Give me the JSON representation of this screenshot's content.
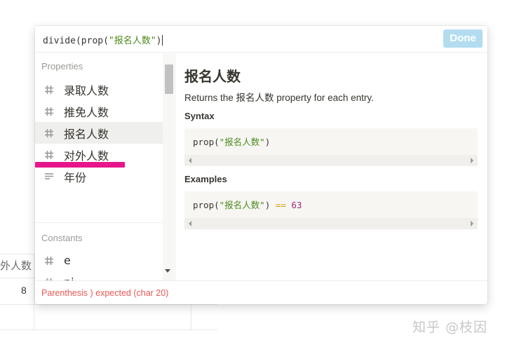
{
  "formula": {
    "prefix": "divide(prop(",
    "string": "\"报名人数\"",
    "suffix": ")"
  },
  "done_label": "Done",
  "properties_title": "Properties",
  "properties": [
    {
      "label": "录取人数",
      "icon": "number-hash-icon"
    },
    {
      "label": "推免人数",
      "icon": "number-hash-icon"
    },
    {
      "label": "报名人数",
      "icon": "number-hash-icon",
      "selected": true
    },
    {
      "label": "对外人数",
      "icon": "number-hash-icon"
    },
    {
      "label": "年份",
      "icon": "text-lines-icon"
    }
  ],
  "constants_title": "Constants",
  "constants": [
    {
      "label": "e",
      "icon": "number-hash-icon"
    },
    {
      "label": "pi",
      "icon": "number-hash-icon"
    },
    {
      "label": "true",
      "icon": "checkbox-icon"
    }
  ],
  "doc": {
    "title": "报名人数",
    "description": "Returns the 报名人数 property for each entry.",
    "syntax_heading": "Syntax",
    "syntax_code": {
      "fn": "prop(",
      "str": "\"报名人数\"",
      "close": ")"
    },
    "examples_heading": "Examples",
    "example_code": {
      "fn": "prop(",
      "str": "\"报名人数\"",
      "close": ")",
      "op": "==",
      "num": "63"
    }
  },
  "error": "Parenthesis ) expected (char 20)",
  "background_table": {
    "header_fragment": "外人数",
    "cell_value": "8"
  },
  "watermark": "知乎 @枝因",
  "colors": {
    "accent_done": "#b3dcf0",
    "error": "#eb5757",
    "string_green": "#4d8a1c",
    "highlight_magenta": "#e6168a"
  }
}
